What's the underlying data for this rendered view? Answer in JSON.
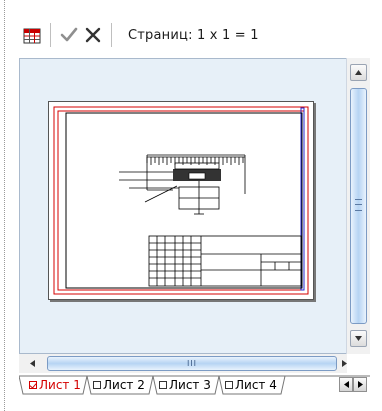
{
  "toolbar": {
    "icons": [
      "pages-grid-icon",
      "checkmark-icon",
      "close-icon"
    ],
    "pages_label": "Страниц: 1 x 1 = 1"
  },
  "scrollbars": {
    "vertical_thumb_grip": "≡",
    "horizontal_thumb_grip": "III"
  },
  "tabs": [
    {
      "label": "Лист 1",
      "active": true
    },
    {
      "label": "Лист 2",
      "active": false
    },
    {
      "label": "Лист 3",
      "active": false
    },
    {
      "label": "Лист 4",
      "active": false
    }
  ],
  "colors": {
    "viewport_bg": "#e7f0f8",
    "active_tab": "#d40000",
    "sheet_frame_red": "#d40000",
    "sheet_frame_blue": "#2a2ad0"
  }
}
